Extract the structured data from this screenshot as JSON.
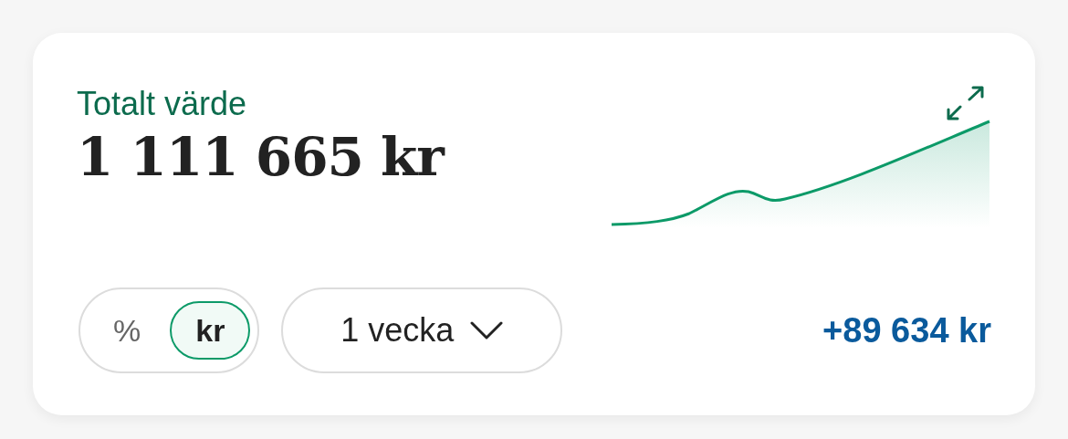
{
  "card": {
    "label": "Totalt värde",
    "value": "1 111 665 kr"
  },
  "unit_toggle": [
    {
      "label": "%",
      "selected": false
    },
    {
      "label": "kr",
      "selected": true
    }
  ],
  "period_dropdown": {
    "value": "1 vecka"
  },
  "change": "+89 634 kr"
}
